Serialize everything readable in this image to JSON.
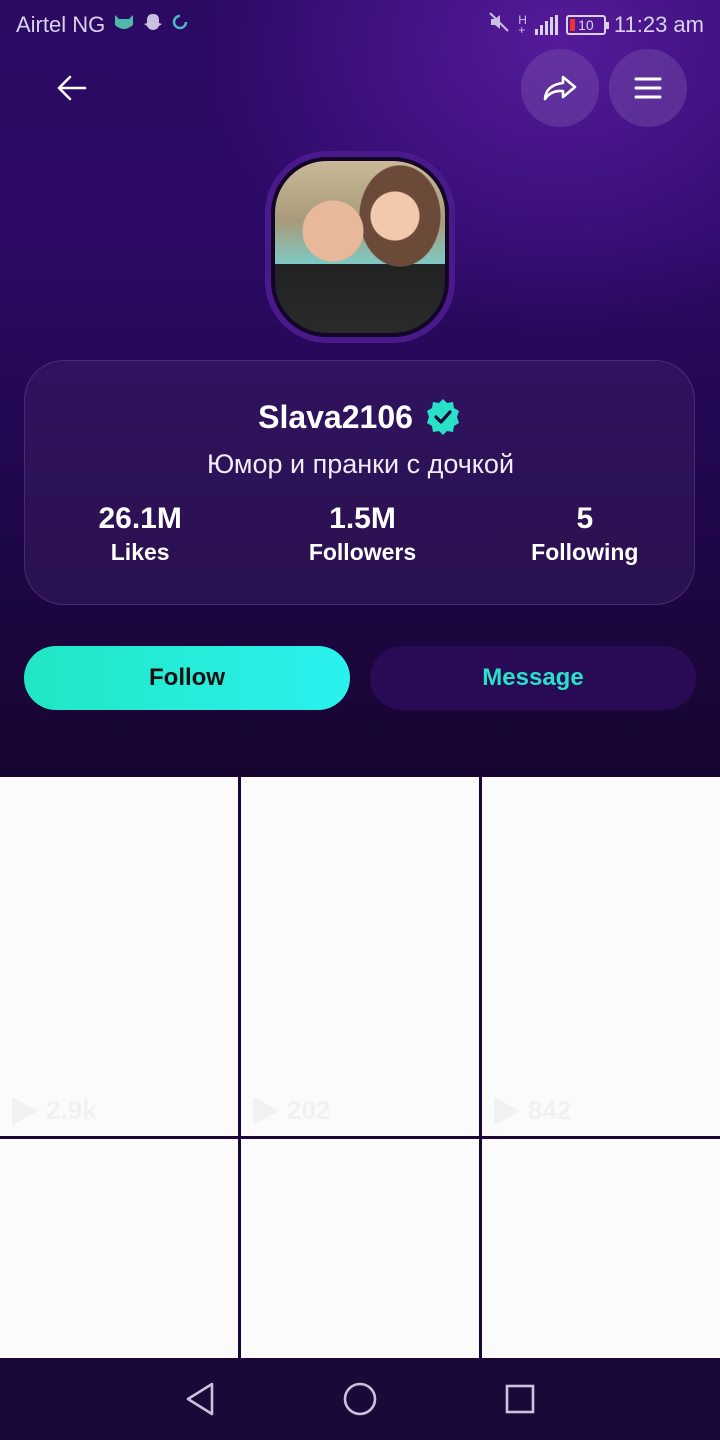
{
  "status_bar": {
    "carrier": "Airtel NG",
    "battery": "10",
    "time": "11:23 am"
  },
  "header": {
    "back_icon": "arrow-left-icon",
    "share_icon": "share-icon",
    "menu_icon": "hamburger-menu-icon"
  },
  "profile": {
    "username": "Slava2106",
    "verified": true,
    "bio": "Юмор и пранки с дочкой",
    "stats": [
      {
        "value": "26.1M",
        "label": "Likes"
      },
      {
        "value": "1.5M",
        "label": "Followers"
      },
      {
        "value": "5",
        "label": "Following"
      }
    ]
  },
  "actions": {
    "follow_label": "Follow",
    "message_label": "Message"
  },
  "videos": [
    {
      "views": "2.9k"
    },
    {
      "views": "202"
    },
    {
      "views": "842"
    },
    {
      "views": ""
    },
    {
      "views": ""
    },
    {
      "views": ""
    }
  ],
  "colors": {
    "accent": "#29E1C9",
    "background": "#1A0838",
    "hero_top": "#2A0A63"
  }
}
